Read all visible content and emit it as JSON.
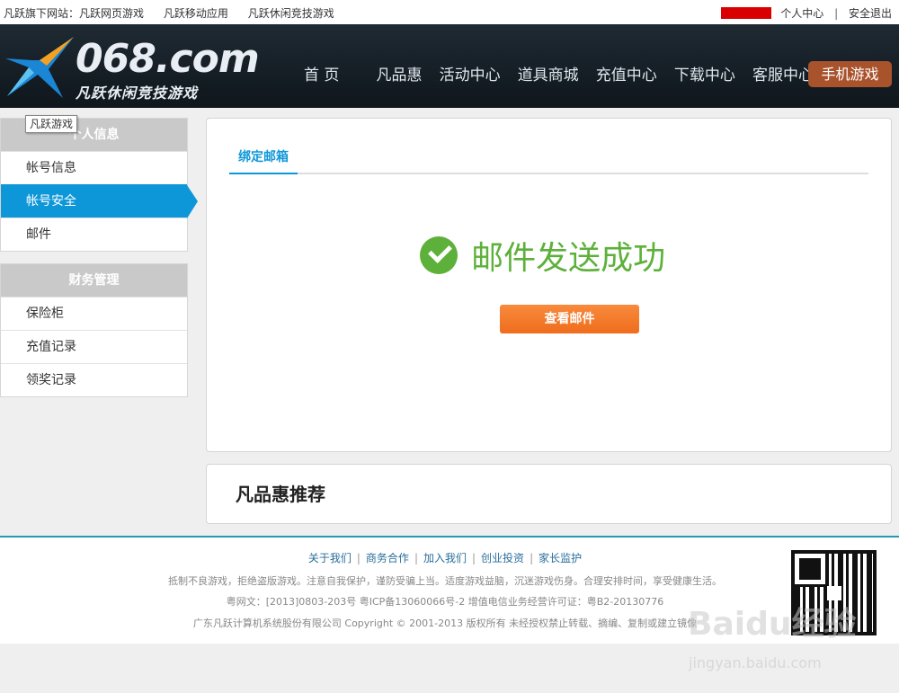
{
  "topbar": {
    "sites": [
      "凡跃旗下网站：凡跃网页游戏",
      "凡跃移动应用",
      "凡跃休闲竞技游戏"
    ],
    "user_center": "个人中心",
    "separator": "|",
    "logout": "安全退出"
  },
  "header": {
    "logo_text": "068.com",
    "logo_sub": "凡跃休闲竞技游戏",
    "nav": [
      "首 页",
      "凡品惠",
      "活动中心",
      "道具商城",
      "充值中心",
      "下载中心",
      "客服中心"
    ],
    "mobile_games": "手机游戏"
  },
  "sidebar": {
    "tooltip": "凡跃游戏",
    "groups": [
      {
        "title": "个人信息",
        "items": [
          "帐号信息",
          "帐号安全",
          "邮件"
        ],
        "active": 1
      },
      {
        "title": "财务管理",
        "items": [
          "保险柜",
          "充值记录",
          "领奖记录"
        ]
      }
    ]
  },
  "main": {
    "tab": "绑定邮箱",
    "success_text": "邮件发送成功",
    "view_button": "查看邮件"
  },
  "recommend": {
    "title": "凡品惠推荐"
  },
  "footer": {
    "links": [
      "关于我们",
      "商务合作",
      "加入我们",
      "创业投资",
      "家长监护"
    ],
    "line1": "抵制不良游戏，拒绝盗版游戏。注意自我保护，谨防受骗上当。适度游戏益脑，沉迷游戏伤身。合理安排时间，享受健康生活。",
    "line2": "粤网文：[2013]0803-203号  粤ICP备13060066号-2  增值电信业务经营许可证：粤B2-20130776",
    "line3": "广东凡跃计算机系统股份有限公司 Copyright © 2001-2013 版权所有 未经授权禁止转载、摘编、复制或建立镜像"
  },
  "watermark": {
    "text": "Baidu经验",
    "sub": "jingyan.baidu.com"
  },
  "colors": {
    "accent": "#0e97d8",
    "success": "#5db13a",
    "button": "#f47a2a",
    "mobile": "#a9532d"
  }
}
